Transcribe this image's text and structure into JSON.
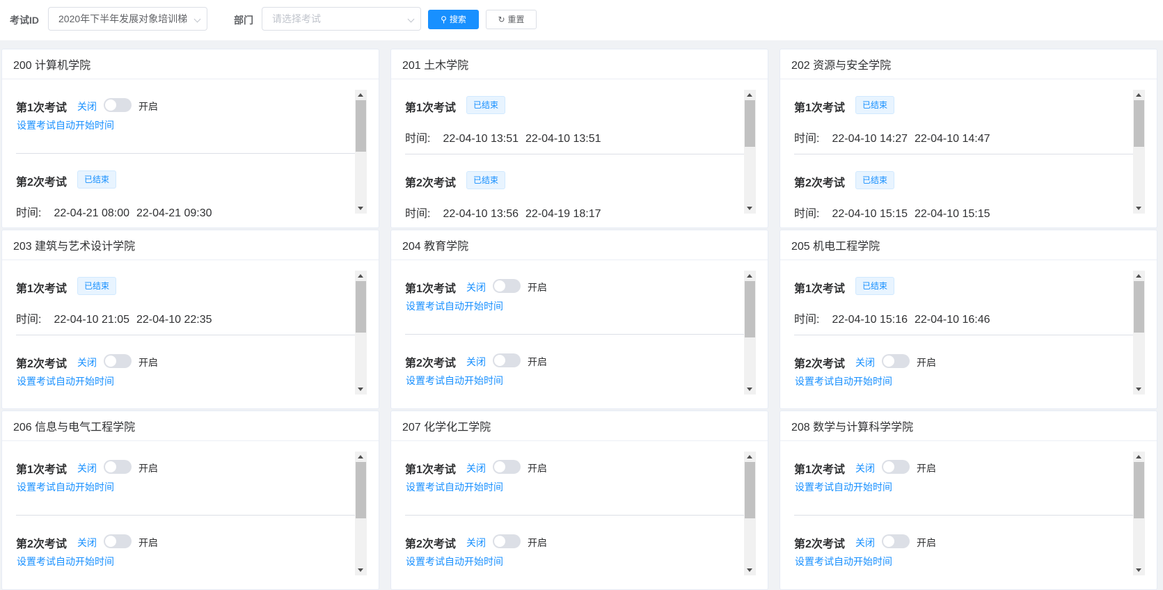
{
  "toolbar": {
    "exam_id_label": "考试ID",
    "exam_id_value": "2020年下半年发展对象培训梯",
    "dept_label": "部门",
    "dept_placeholder": "请选择考试",
    "search_label": "搜索",
    "reset_label": "重置"
  },
  "labels": {
    "status_ended": "已结束",
    "time_label": "时间:",
    "switch_off": "关闭",
    "switch_on": "开启",
    "auto_start": "设置考试自动开始时间"
  },
  "colors": {
    "primary": "#1890ff",
    "tag_bg": "#e8f4ff",
    "background": "#f0f2f5"
  },
  "cards": [
    {
      "title": "200 计算机学院",
      "scroll_fraction": 0.5,
      "exams": [
        {
          "name": "第1次考试",
          "state": "toggle",
          "enabled": false
        },
        {
          "name": "第2次考试",
          "state": "ended",
          "start": "22-04-21 08:00",
          "end": "22-04-21 09:30"
        }
      ]
    },
    {
      "title": "201 土木学院",
      "scroll_fraction": 0.45,
      "exams": [
        {
          "name": "第1次考试",
          "state": "ended",
          "start": "22-04-10 13:51",
          "end": "22-04-10 13:51"
        },
        {
          "name": "第2次考试",
          "state": "ended",
          "start": "22-04-10 13:56",
          "end": "22-04-19 18:17"
        }
      ]
    },
    {
      "title": "202 资源与安全学院",
      "scroll_fraction": 0.45,
      "exams": [
        {
          "name": "第1次考试",
          "state": "ended",
          "start": "22-04-10 14:27",
          "end": "22-04-10 14:47"
        },
        {
          "name": "第2次考试",
          "state": "ended",
          "start": "22-04-10 15:15",
          "end": "22-04-10 15:15"
        }
      ]
    },
    {
      "title": "203 建筑与艺术设计学院",
      "scroll_fraction": 0.5,
      "exams": [
        {
          "name": "第1次考试",
          "state": "ended",
          "start": "22-04-10 21:05",
          "end": "22-04-10 22:35"
        },
        {
          "name": "第2次考试",
          "state": "toggle",
          "enabled": false
        }
      ]
    },
    {
      "title": "204 教育学院",
      "scroll_fraction": 0.55,
      "exams": [
        {
          "name": "第1次考试",
          "state": "toggle",
          "enabled": false
        },
        {
          "name": "第2次考试",
          "state": "toggle",
          "enabled": false
        }
      ]
    },
    {
      "title": "205 机电工程学院",
      "scroll_fraction": 0.5,
      "exams": [
        {
          "name": "第1次考试",
          "state": "ended",
          "start": "22-04-10 15:16",
          "end": "22-04-10 16:46"
        },
        {
          "name": "第2次考试",
          "state": "toggle",
          "enabled": false
        }
      ]
    },
    {
      "title": "206 信息与电气工程学院",
      "scroll_fraction": 0.55,
      "exams": [
        {
          "name": "第1次考试",
          "state": "toggle",
          "enabled": false
        },
        {
          "name": "第2次考试",
          "state": "toggle",
          "enabled": false
        }
      ]
    },
    {
      "title": "207 化学化工学院",
      "scroll_fraction": 0.55,
      "exams": [
        {
          "name": "第1次考试",
          "state": "toggle",
          "enabled": false
        },
        {
          "name": "第2次考试",
          "state": "toggle",
          "enabled": false
        }
      ]
    },
    {
      "title": "208 数学与计算科学学院",
      "scroll_fraction": 0.55,
      "exams": [
        {
          "name": "第1次考试",
          "state": "toggle",
          "enabled": false
        },
        {
          "name": "第2次考试",
          "state": "toggle",
          "enabled": false
        }
      ]
    }
  ]
}
